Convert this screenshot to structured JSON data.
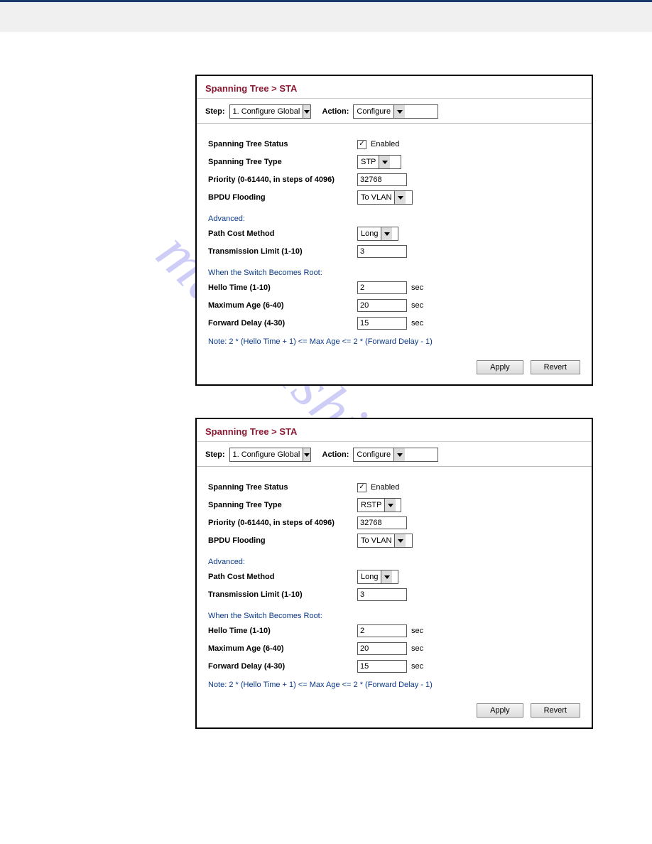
{
  "breadcrumb": "Spanning Tree > STA",
  "stepLabel": "Step:",
  "actionLabel": "Action:",
  "stepSelect": "1. Configure Global",
  "actionSelect": "Configure",
  "fields": {
    "status_label": "Spanning Tree Status",
    "status_enabled": "Enabled",
    "type_label": "Spanning Tree Type",
    "priority_label": "Priority (0-61440, in steps of 4096)",
    "priority_value": "32768",
    "bpdu_label": "BPDU Flooding",
    "bpdu_value": "To VLAN",
    "advanced_header": "Advanced:",
    "pcm_label": "Path Cost Method",
    "pcm_value": "Long",
    "txlimit_label": "Transmission Limit (1-10)",
    "txlimit_value": "3",
    "root_header": "When the Switch Becomes Root:",
    "hello_label": "Hello Time (1-10)",
    "hello_value": "2",
    "maxage_label": "Maximum Age (6-40)",
    "maxage_value": "20",
    "fwd_label": "Forward Delay (4-30)",
    "fwd_value": "15",
    "sec_unit": "sec",
    "note": "Note: 2 * (Hello Time + 1) <= Max Age <= 2 * (Forward Delay - 1)"
  },
  "panel1_type": "STP",
  "panel2_type": "RSTP",
  "buttons": {
    "apply": "Apply",
    "revert": "Revert"
  },
  "watermark": "manualshive.com"
}
